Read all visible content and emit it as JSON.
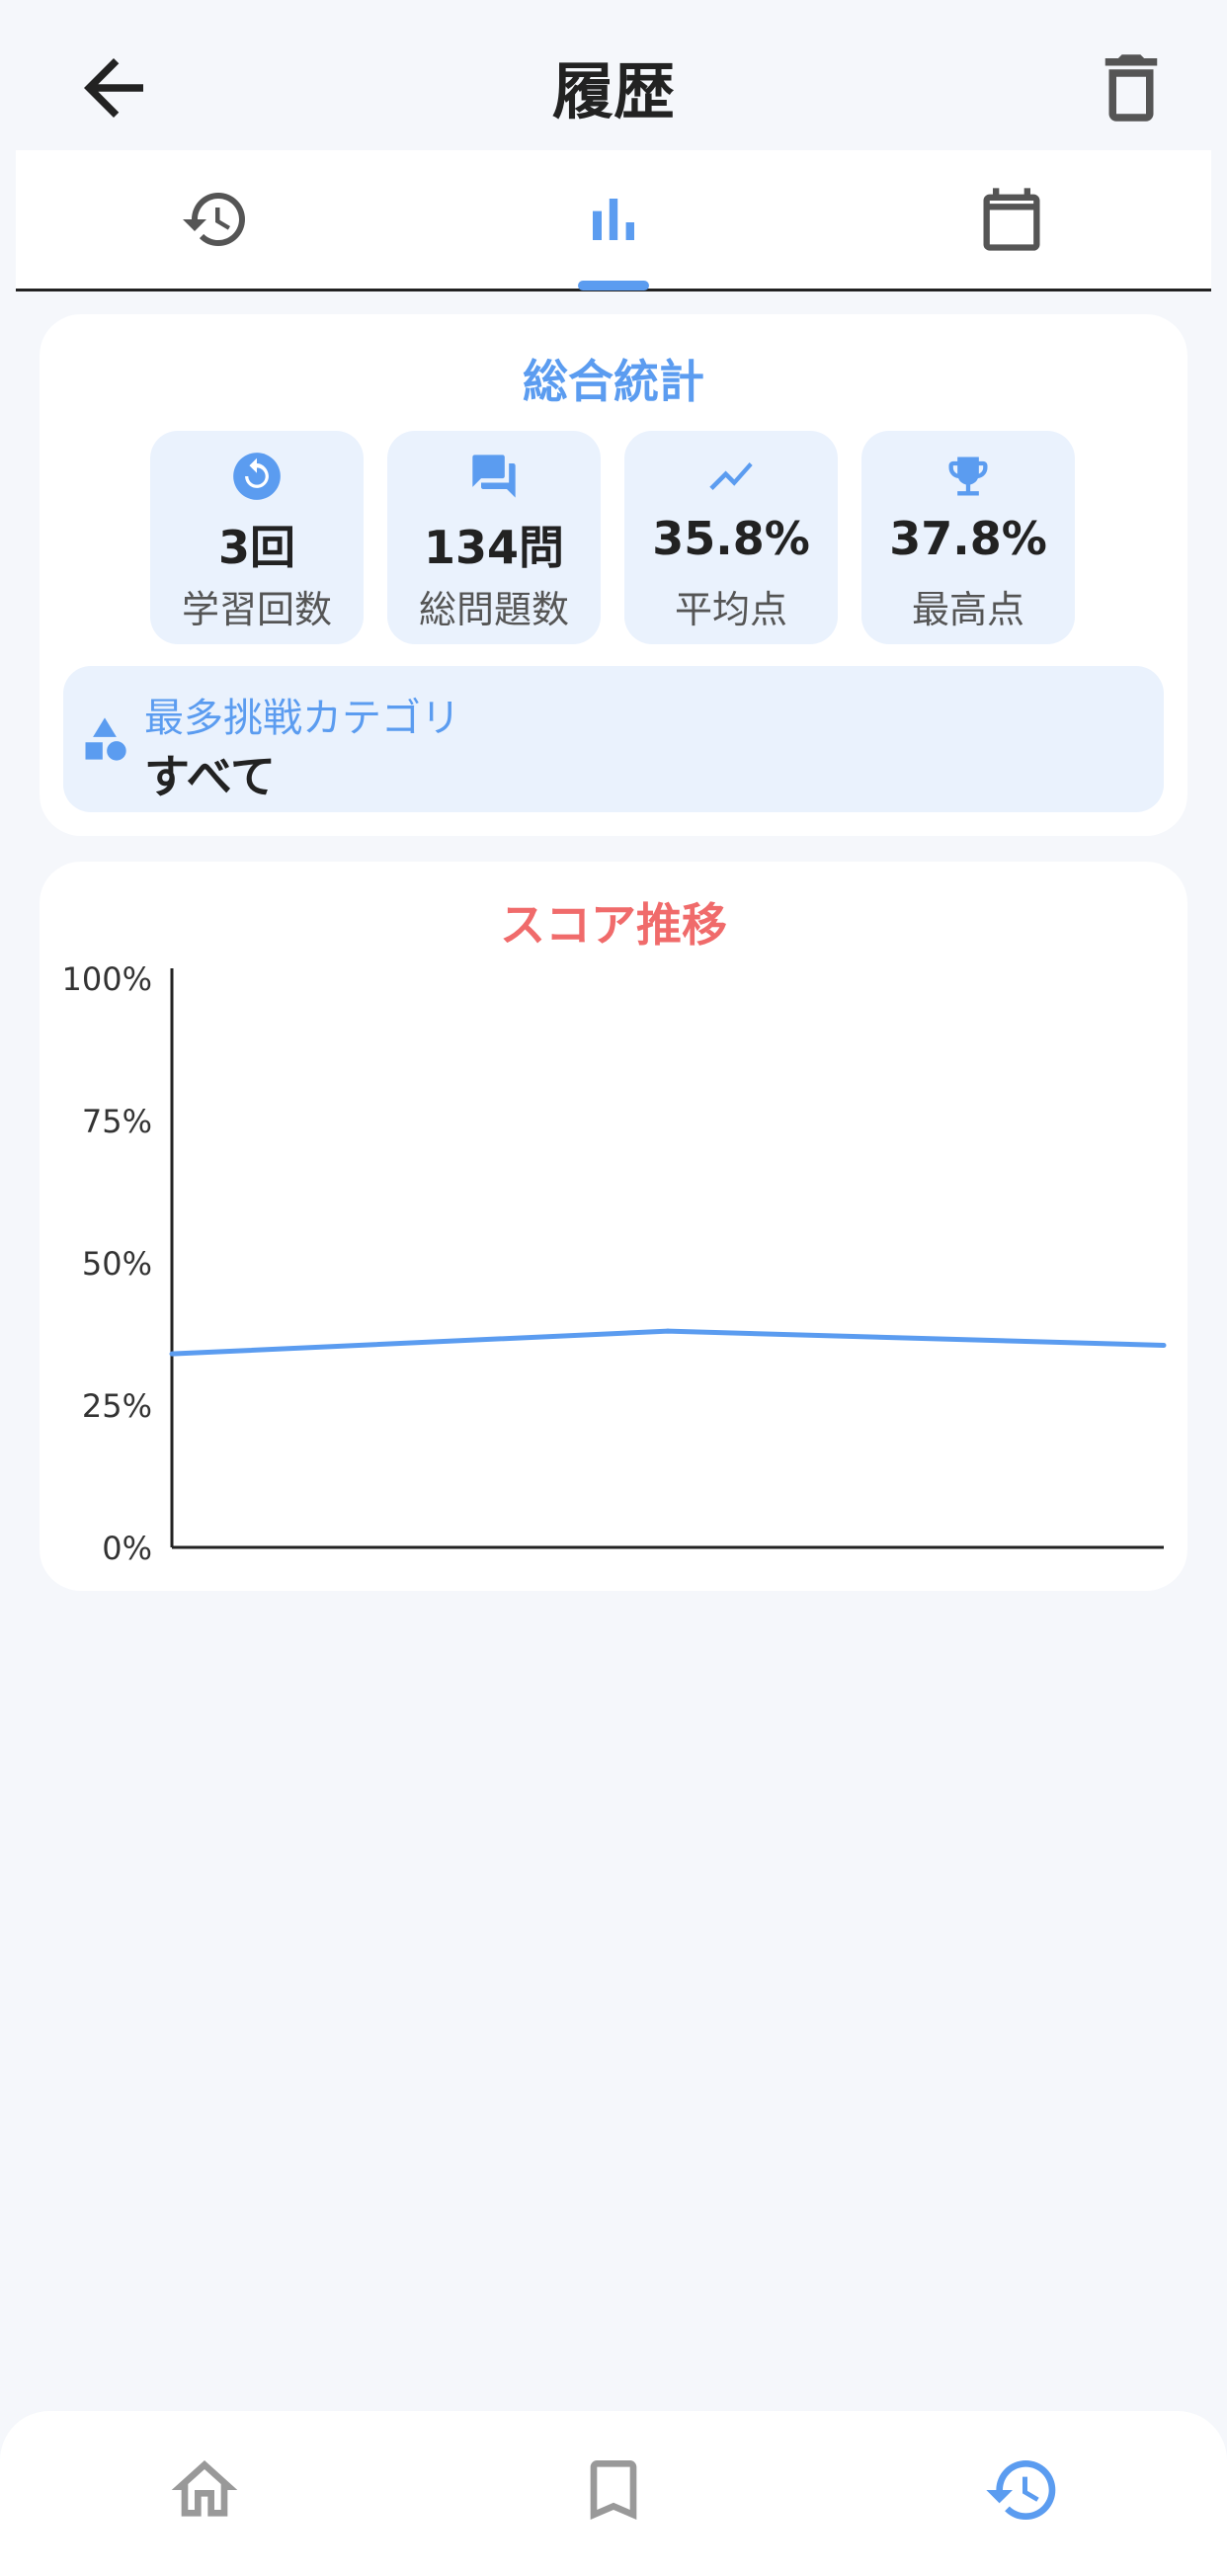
{
  "header": {
    "title": "履歴",
    "back_icon": "arrow-back-icon",
    "delete_icon": "trash-icon"
  },
  "tabs": [
    {
      "icon": "history-icon",
      "active": false
    },
    {
      "icon": "bar-chart-icon",
      "active": true
    },
    {
      "icon": "calendar-icon",
      "active": false
    }
  ],
  "summary": {
    "title": "総合統計",
    "stats": [
      {
        "icon": "replay-icon",
        "value": "3回",
        "label": "学習回数"
      },
      {
        "icon": "chat-icon",
        "value": "134問",
        "label": "総問題数"
      },
      {
        "icon": "trend-icon",
        "value": "35.8%",
        "label": "平均点"
      },
      {
        "icon": "trophy-icon",
        "value": "37.8%",
        "label": "最高点"
      }
    ],
    "top_category": {
      "icon": "category-icon",
      "label": "最多挑戦カテゴリ",
      "value": "すべて"
    }
  },
  "chart_card": {
    "title": "スコア推移"
  },
  "chart_data": {
    "type": "line",
    "title": "スコア推移",
    "x": [
      1,
      2,
      3
    ],
    "series": [
      {
        "values": [
          34,
          38,
          35.5
        ]
      }
    ],
    "ylim": [
      0,
      100
    ],
    "yticks": [
      "0%",
      "25%",
      "50%",
      "75%",
      "100%"
    ],
    "xlabel": "",
    "ylabel": "",
    "grid": false,
    "legend": "none"
  },
  "bottom_nav": [
    {
      "icon": "home-icon",
      "active": false
    },
    {
      "icon": "bookmark-icon",
      "active": false
    },
    {
      "icon": "history-icon",
      "active": true
    }
  ],
  "colors": {
    "accent": "#5b9cf0",
    "chart_title": "#f06b6b",
    "inactive": "#6b6b6b",
    "tile_bg": "#eaf2fd"
  }
}
